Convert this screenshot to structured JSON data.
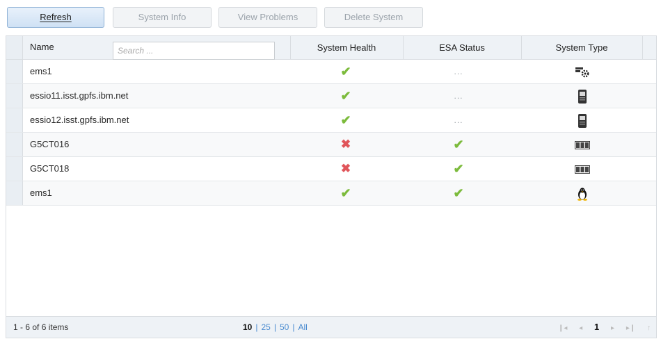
{
  "toolbar": {
    "refresh": "Refresh",
    "system_info": "System Info",
    "view_problems": "View Problems",
    "delete_system": "Delete System"
  },
  "table": {
    "columns": {
      "name": "Name",
      "health": "System Health",
      "esa": "ESA Status",
      "type": "System Type"
    },
    "search_placeholder": "Search ...",
    "rows": [
      {
        "name": "ems1",
        "health": "ok",
        "esa": "...",
        "type": "management-server-icon"
      },
      {
        "name": "essio11.isst.gpfs.ibm.net",
        "health": "ok",
        "esa": "...",
        "type": "server-tower-icon"
      },
      {
        "name": "essio12.isst.gpfs.ibm.net",
        "health": "ok",
        "esa": "...",
        "type": "server-tower-icon"
      },
      {
        "name": "G5CT016",
        "health": "error",
        "esa": "ok",
        "type": "storage-enclosure-icon"
      },
      {
        "name": "G5CT018",
        "health": "error",
        "esa": "ok",
        "type": "storage-enclosure-icon"
      },
      {
        "name": "ems1",
        "health": "ok",
        "esa": "ok",
        "type": "linux-tux-icon"
      }
    ]
  },
  "footer": {
    "count": "1 - 6 of 6 items",
    "page_sizes": [
      "10",
      "25",
      "50",
      "All"
    ],
    "current_page_size": "10",
    "current_page": "1"
  },
  "colors": {
    "ok": "#7cbb3c",
    "error": "#e0555a",
    "link": "#4a8bd0",
    "header_bg": "#eef2f6"
  }
}
